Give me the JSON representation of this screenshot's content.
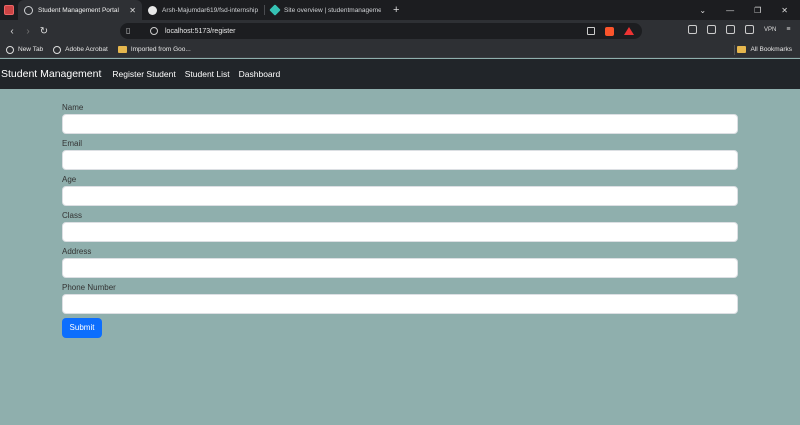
{
  "browser": {
    "tabs": [
      {
        "title": "Student Management Portal",
        "active": true
      },
      {
        "title": "Arsh-Majumdar619/fsd-internship",
        "active": false
      },
      {
        "title": "Site overview | studentmanagement",
        "active": false
      }
    ],
    "url": "localhost:5173/register",
    "vpn_label": "VPN",
    "bookmarks": [
      {
        "label": "New Tab"
      },
      {
        "label": "Adobe Acrobat"
      },
      {
        "label": "Imported from Goo..."
      }
    ],
    "all_bookmarks_label": "All Bookmarks"
  },
  "navbar": {
    "brand": "Student Management",
    "links": [
      "Register Student",
      "Student List",
      "Dashboard"
    ]
  },
  "form": {
    "fields": [
      {
        "label": "Name",
        "value": ""
      },
      {
        "label": "Email",
        "value": ""
      },
      {
        "label": "Age",
        "value": ""
      },
      {
        "label": "Class",
        "value": ""
      },
      {
        "label": "Address",
        "value": ""
      },
      {
        "label": "Phone Number",
        "value": ""
      }
    ],
    "submit_label": "Submit"
  },
  "colors": {
    "page_bg": "#8fafad",
    "navbar_bg": "#212529",
    "submit_bg": "#0d6efd"
  }
}
